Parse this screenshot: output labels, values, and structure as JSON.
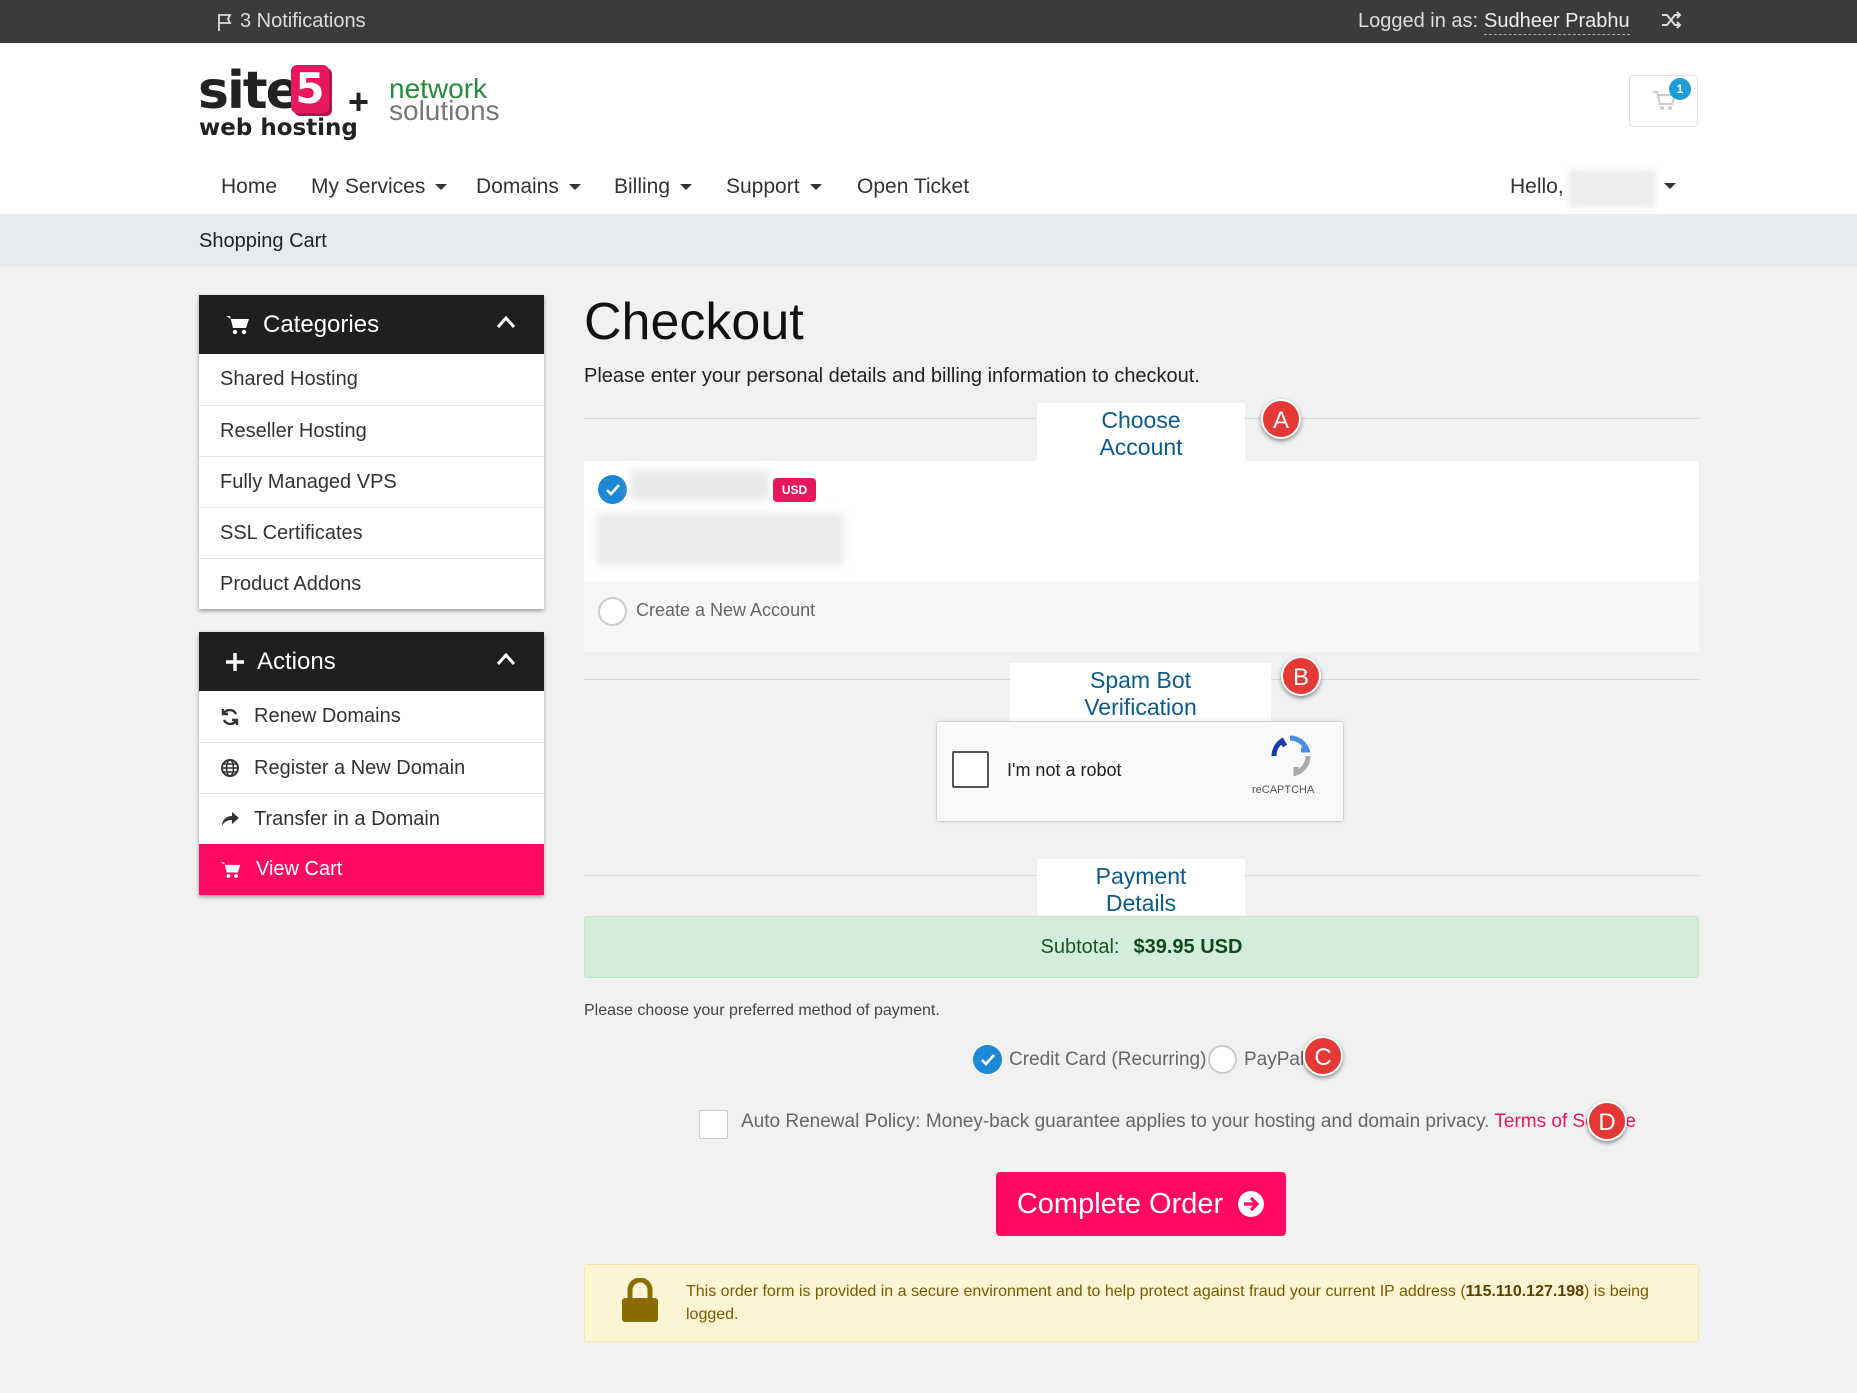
{
  "topbar": {
    "notifications": "3 Notifications",
    "logged_in_as": "Logged in as:",
    "user_name": "Sudheer Prabhu"
  },
  "logo": {
    "site": "site",
    "five": "5",
    "web_hosting": "web hosting",
    "plus": "+",
    "ns_line1": "network",
    "ns_line2": "solutions"
  },
  "cart": {
    "count": "1"
  },
  "nav": {
    "items": [
      {
        "label": "Home",
        "dropdown": false
      },
      {
        "label": "My Services",
        "dropdown": true
      },
      {
        "label": "Domains",
        "dropdown": true
      },
      {
        "label": "Billing",
        "dropdown": true
      },
      {
        "label": "Support",
        "dropdown": true
      },
      {
        "label": "Open Ticket",
        "dropdown": false
      }
    ],
    "hello": "Hello,"
  },
  "breadcrumb": "Shopping Cart",
  "sidebar": {
    "categories": {
      "title": "Categories",
      "items": [
        "Shared Hosting",
        "Reseller Hosting",
        "Fully Managed VPS",
        "SSL Certificates",
        "Product Addons"
      ]
    },
    "actions": {
      "title": "Actions",
      "items": [
        "Renew Domains",
        "Register a New Domain",
        "Transfer in a Domain",
        "View Cart"
      ]
    }
  },
  "main": {
    "title": "Checkout",
    "intro": "Please enter your personal details and billing information to checkout.",
    "choose_account": "Choose Account",
    "currency_badge": "USD",
    "create_account": "Create a New Account",
    "spam_title": "Spam Bot Verification",
    "captcha_label": "I'm not a robot",
    "captcha_brand": "reCAPTCHA",
    "payment_title": "Payment Details",
    "subtotal_label": "Subtotal:",
    "subtotal_value": "$39.95 USD",
    "choose_payment": "Please choose your preferred method of payment.",
    "payment_options": [
      "Credit Card (Recurring)",
      "PayPal"
    ],
    "tos_text": "Auto Renewal Policy: Money-back guarantee applies to your hosting and domain privacy.",
    "tos_link": "Terms of Service",
    "complete_button": "Complete Order",
    "secure_pre": "This order form is provided in a secure environment and to help protect against fraud your current IP address (",
    "secure_ip": "115.110.127.198",
    "secure_post": ") is being logged."
  },
  "markers": [
    "A",
    "B",
    "C",
    "D"
  ],
  "colors": {
    "accent": "#ff0a62",
    "link_blue": "#0a5a8a",
    "check_blue": "#1e88d6"
  }
}
